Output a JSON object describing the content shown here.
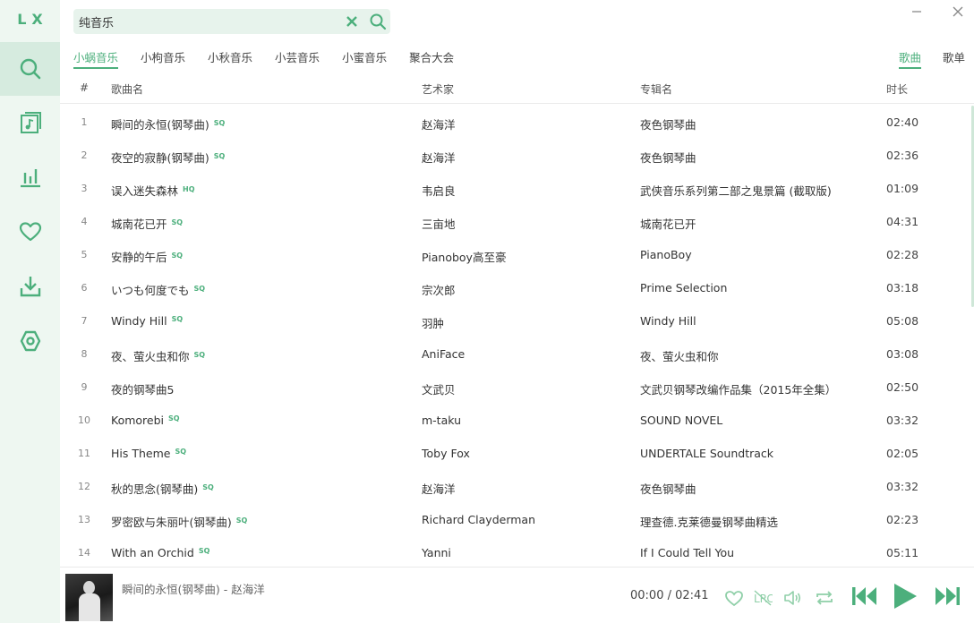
{
  "app": {
    "logo": "LX"
  },
  "search": {
    "value": "纯音乐"
  },
  "source_tabs": [
    "小蜗音乐",
    "小枸音乐",
    "小秋音乐",
    "小芸音乐",
    "小蜜音乐",
    "聚合大会"
  ],
  "type_tabs": [
    "歌曲",
    "歌单"
  ],
  "table": {
    "headers": {
      "num": "#",
      "name": "歌曲名",
      "artist": "艺术家",
      "album": "专辑名",
      "duration": "时长"
    },
    "rows": [
      {
        "num": "1",
        "name": "瞬间的永恒(钢琴曲)",
        "quality": "SQ",
        "artist": "赵海洋",
        "album": "夜色钢琴曲",
        "duration": "02:40"
      },
      {
        "num": "2",
        "name": "夜空的寂静(钢琴曲)",
        "quality": "SQ",
        "artist": "赵海洋",
        "album": "夜色钢琴曲",
        "duration": "02:36"
      },
      {
        "num": "3",
        "name": "误入迷失森林",
        "quality": "HQ",
        "artist": "韦启良",
        "album": "武侠音乐系列第二部之鬼景篇 (截取版)",
        "duration": "01:09"
      },
      {
        "num": "4",
        "name": "城南花已开",
        "quality": "SQ",
        "artist": "三亩地",
        "album": "城南花已开",
        "duration": "04:31"
      },
      {
        "num": "5",
        "name": "安静的午后",
        "quality": "SQ",
        "artist": "Pianoboy高至豪",
        "album": "PianoBoy",
        "duration": "02:28"
      },
      {
        "num": "6",
        "name": "いつも何度でも",
        "quality": "SQ",
        "artist": "宗次郎",
        "album": "Prime Selection",
        "duration": "03:18"
      },
      {
        "num": "7",
        "name": "Windy Hill",
        "quality": "SQ",
        "artist": "羽肿",
        "album": "Windy Hill",
        "duration": "05:08"
      },
      {
        "num": "8",
        "name": "夜、萤火虫和你",
        "quality": "SQ",
        "artist": "AniFace",
        "album": "夜、萤火虫和你",
        "duration": "03:08"
      },
      {
        "num": "9",
        "name": "夜的钢琴曲5",
        "quality": "",
        "artist": "文武贝",
        "album": "文武贝钢琴改编作品集（2015年全集）",
        "duration": "02:50"
      },
      {
        "num": "10",
        "name": "Komorebi",
        "quality": "SQ",
        "artist": "m-taku",
        "album": "SOUND NOVEL",
        "duration": "03:32"
      },
      {
        "num": "11",
        "name": "His Theme",
        "quality": "SQ",
        "artist": "Toby Fox",
        "album": "UNDERTALE Soundtrack",
        "duration": "02:05"
      },
      {
        "num": "12",
        "name": "秋的思念(钢琴曲)",
        "quality": "SQ",
        "artist": "赵海洋",
        "album": "夜色钢琴曲",
        "duration": "03:32"
      },
      {
        "num": "13",
        "name": "罗密欧与朱丽叶(钢琴曲)",
        "quality": "SQ",
        "artist": "Richard Clayderman",
        "album": "理查德.克莱德曼钢琴曲精选",
        "duration": "02:23"
      },
      {
        "num": "14",
        "name": "With an Orchid",
        "quality": "SQ",
        "artist": "Yanni",
        "album": "If I Could Tell You",
        "duration": "05:11"
      }
    ]
  },
  "player": {
    "track": "瞬间的永恒(钢琴曲) - 赵海洋",
    "time": "00:00 / 02:41"
  },
  "icons": {
    "nav": [
      "search-icon",
      "music-list-icon",
      "leaderboard-icon",
      "heart-icon",
      "download-icon",
      "settings-icon"
    ],
    "player": [
      "heart-icon",
      "lyrics-icon",
      "volume-icon",
      "repeat-icon",
      "previous-icon",
      "play-icon",
      "next-icon"
    ]
  },
  "colors": {
    "accent": "#4caf7c",
    "sidebar_bg": "#eef7f1",
    "active_nav_bg": "#d6ebdf",
    "search_bg": "#e7f3ec"
  }
}
